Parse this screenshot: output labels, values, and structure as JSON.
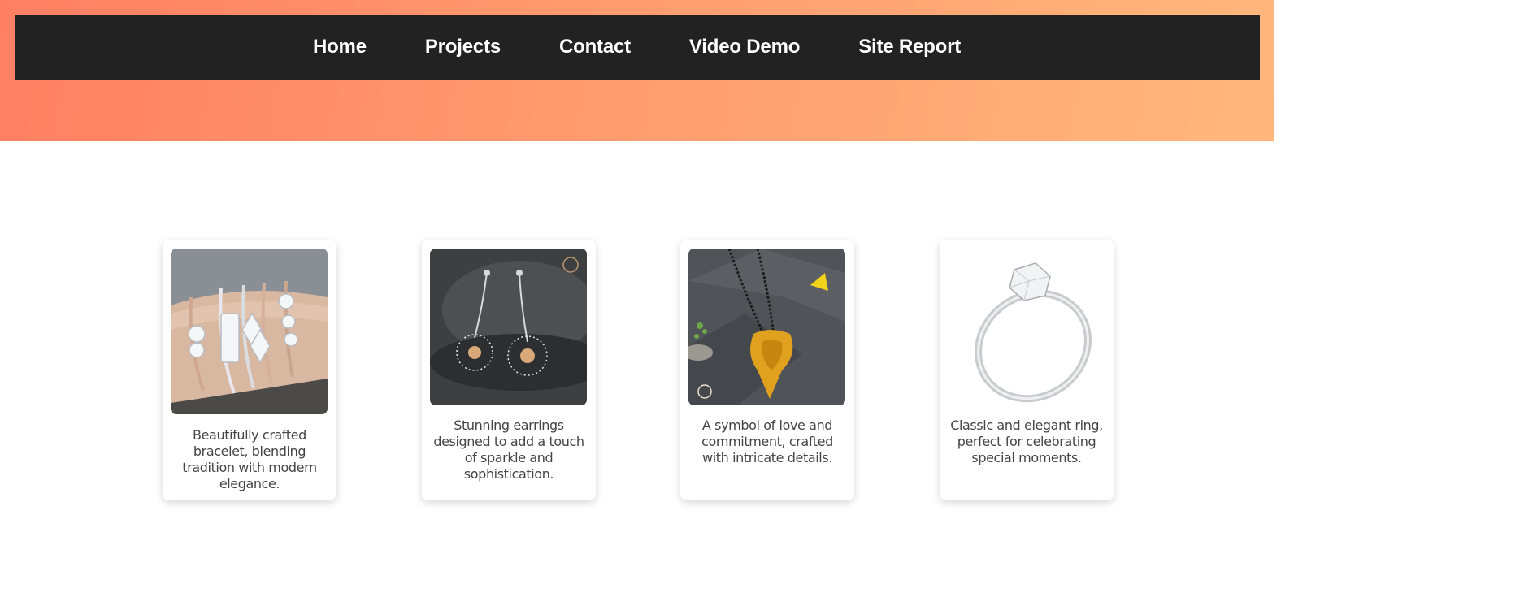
{
  "nav": {
    "items": [
      {
        "label": "Home"
      },
      {
        "label": "Projects"
      },
      {
        "label": "Contact"
      },
      {
        "label": "Video Demo"
      },
      {
        "label": "Site Report"
      }
    ]
  },
  "products": [
    {
      "description": "Beautifully crafted bracelet, blending tradition with modern elegance.",
      "image": "bracelets-on-wrist"
    },
    {
      "description": "Stunning earrings designed to add a touch of sparkle and sophistication.",
      "image": "diamond-earrings"
    },
    {
      "description": "A symbol of love and commitment, crafted with intricate details.",
      "image": "gold-mangalsutra-necklace"
    },
    {
      "description": "Classic and elegant ring, perfect for celebrating special moments.",
      "image": "solitaire-ring"
    }
  ],
  "colors": {
    "hero_start": "#ff7f62",
    "hero_end": "#ffb77c",
    "navbar": "#222222",
    "nav_text": "#ffffff",
    "card_text": "#444444"
  }
}
